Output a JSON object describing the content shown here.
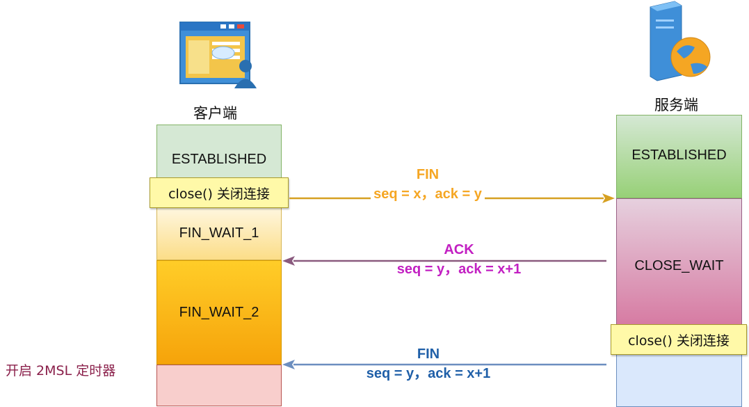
{
  "client": {
    "label": "客户端",
    "states": [
      "ESTABLISHED",
      "FIN_WAIT_1",
      "FIN_WAIT_2"
    ],
    "close_note": "close() 关闭连接",
    "timer_label": "开启 2MSL 定时器"
  },
  "server": {
    "label": "服务端",
    "states": [
      "ESTABLISHED",
      "CLOSE_WAIT"
    ],
    "close_note": "close() 关闭连接"
  },
  "messages": [
    {
      "name": "FIN",
      "detail": "seq = x，ack = y",
      "color": "#f5a623",
      "line_color": "#d6a021",
      "direction": "client-to-server"
    },
    {
      "name": "ACK",
      "detail": "seq = y，ack = x+1",
      "color": "#c21fc2",
      "line_color": "#8a5a7e",
      "direction": "server-to-client"
    },
    {
      "name": "FIN",
      "detail": "seq = y，ack = x+1",
      "color": "#1f5fa8",
      "line_color": "#6c8ebf",
      "direction": "server-to-client"
    }
  ],
  "colors": {
    "established_fill": "#d5e8d4",
    "established_border": "#82b366",
    "fin_wait_1_fill": "#fde9b2",
    "fin_wait_2_fill": "#f9b10f",
    "close_wait_fill": "#e6c0d2",
    "time_wait_fill": "#f8cecc",
    "server_bottom_fill": "#dae8fc"
  },
  "icons": {
    "client": "web-browser-user-icon",
    "server": "server-globe-icon"
  }
}
